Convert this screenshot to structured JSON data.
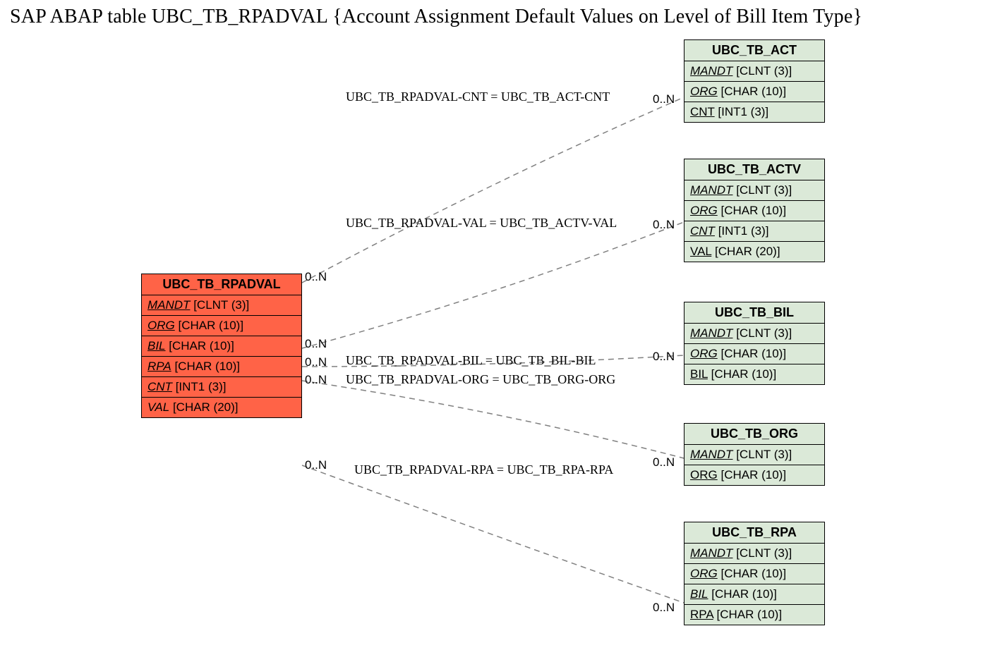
{
  "title": "SAP ABAP table UBC_TB_RPADVAL {Account Assignment Default Values on Level of Bill Item Type}",
  "main": {
    "name": "UBC_TB_RPADVAL",
    "fields": {
      "f0": {
        "key": "MANDT",
        "type": "[CLNT (3)]"
      },
      "f1": {
        "key": "ORG",
        "type": "[CHAR (10)]"
      },
      "f2": {
        "key": "BIL",
        "type": "[CHAR (10)]"
      },
      "f3": {
        "key": "RPA",
        "type": "[CHAR (10)]"
      },
      "f4": {
        "key": "CNT",
        "type": "[INT1 (3)]"
      },
      "f5": {
        "key": "VAL",
        "type": "[CHAR (20)]"
      }
    }
  },
  "refs": {
    "act": {
      "name": "UBC_TB_ACT",
      "fields": {
        "f0": {
          "key": "MANDT",
          "type": "[CLNT (3)]"
        },
        "f1": {
          "key": "ORG",
          "type": "[CHAR (10)]"
        },
        "f2": {
          "key": "CNT",
          "type": "[INT1 (3)]"
        }
      }
    },
    "actv": {
      "name": "UBC_TB_ACTV",
      "fields": {
        "f0": {
          "key": "MANDT",
          "type": "[CLNT (3)]"
        },
        "f1": {
          "key": "ORG",
          "type": "[CHAR (10)]"
        },
        "f2": {
          "key": "CNT",
          "type": "[INT1 (3)]"
        },
        "f3": {
          "key": "VAL",
          "type": "[CHAR (20)]"
        }
      }
    },
    "bil": {
      "name": "UBC_TB_BIL",
      "fields": {
        "f0": {
          "key": "MANDT",
          "type": "[CLNT (3)]"
        },
        "f1": {
          "key": "ORG",
          "type": "[CHAR (10)]"
        },
        "f2": {
          "key": "BIL",
          "type": "[CHAR (10)]"
        }
      }
    },
    "org": {
      "name": "UBC_TB_ORG",
      "fields": {
        "f0": {
          "key": "MANDT",
          "type": "[CLNT (3)]"
        },
        "f1": {
          "key": "ORG",
          "type": "[CHAR (10)]"
        }
      }
    },
    "rpa": {
      "name": "UBC_TB_RPA",
      "fields": {
        "f0": {
          "key": "MANDT",
          "type": "[CLNT (3)]"
        },
        "f1": {
          "key": "ORG",
          "type": "[CHAR (10)]"
        },
        "f2": {
          "key": "BIL",
          "type": "[CHAR (10)]"
        },
        "f3": {
          "key": "RPA",
          "type": "[CHAR (10)]"
        }
      }
    }
  },
  "joins": {
    "j0": "UBC_TB_RPADVAL-CNT = UBC_TB_ACT-CNT",
    "j1": "UBC_TB_RPADVAL-VAL = UBC_TB_ACTV-VAL",
    "j2": "UBC_TB_RPADVAL-BIL = UBC_TB_BIL-BIL",
    "j3": "UBC_TB_RPADVAL-ORG = UBC_TB_ORG-ORG",
    "j4": "UBC_TB_RPADVAL-RPA = UBC_TB_RPA-RPA"
  },
  "card": {
    "left": {
      "c0": "0..N",
      "c1": "0..N",
      "c2": "0..N",
      "c3": "0..N",
      "c4": "0..N"
    },
    "right": {
      "c0": "0..N",
      "c1": "0..N",
      "c2": "0..N",
      "c3": "0..N",
      "c4": "0..N"
    }
  }
}
